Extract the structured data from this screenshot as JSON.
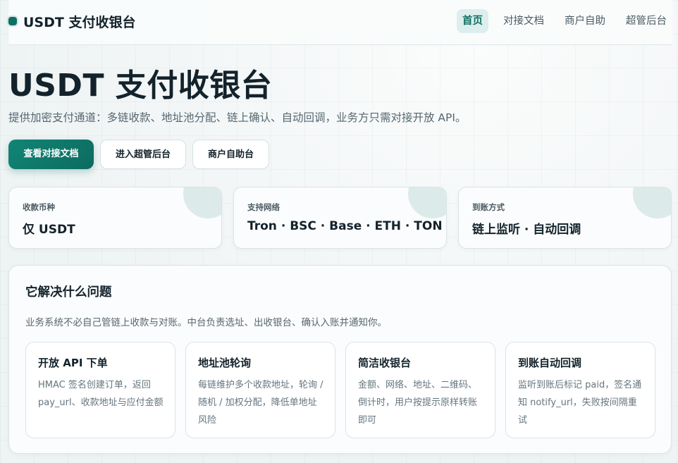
{
  "brand": {
    "title": "USDT 支付收银台"
  },
  "nav": {
    "items": [
      {
        "label": "首页",
        "active": true
      },
      {
        "label": "对接文档",
        "active": false
      },
      {
        "label": "商户自助",
        "active": false
      },
      {
        "label": "超管后台",
        "active": false
      }
    ]
  },
  "hero": {
    "title": "USDT 支付收银台",
    "subtitle": "提供加密支付通道：多链收款、地址池分配、链上确认、自动回调，业务方只需对接开放 API。"
  },
  "actions": {
    "docs": "查看对接文档",
    "admin": "进入超管后台",
    "merchant": "商户自助台"
  },
  "stats": [
    {
      "label": "收款币种",
      "value": "仅 USDT"
    },
    {
      "label": "支持网络",
      "value": "Tron · BSC · Base · ETH · TON"
    },
    {
      "label": "到账方式",
      "value": "链上监听 · 自动回调"
    }
  ],
  "problem": {
    "title": "它解决什么问题",
    "description": "业务系统不必自己管链上收款与对账。中台负责选址、出收银台、确认入账并通知你。",
    "features": [
      {
        "title": "开放 API 下单",
        "description": "HMAC 签名创建订单，返回 pay_url、收款地址与应付金额"
      },
      {
        "title": "地址池轮询",
        "description": "每链维护多个收款地址，轮询 / 随机 / 加权分配，降低单地址风险"
      },
      {
        "title": "简洁收银台",
        "description": "金额、网络、地址、二维码、倒计时，用户按提示原样转账即可"
      },
      {
        "title": "到账自动回调",
        "description": "监听到账后标记 paid，签名通知 notify_url，失败按间隔重试"
      }
    ]
  },
  "colors": {
    "accent": "#0f6f65",
    "accent_light": "#dceeed",
    "text": "#13222b",
    "muted": "#566770"
  }
}
